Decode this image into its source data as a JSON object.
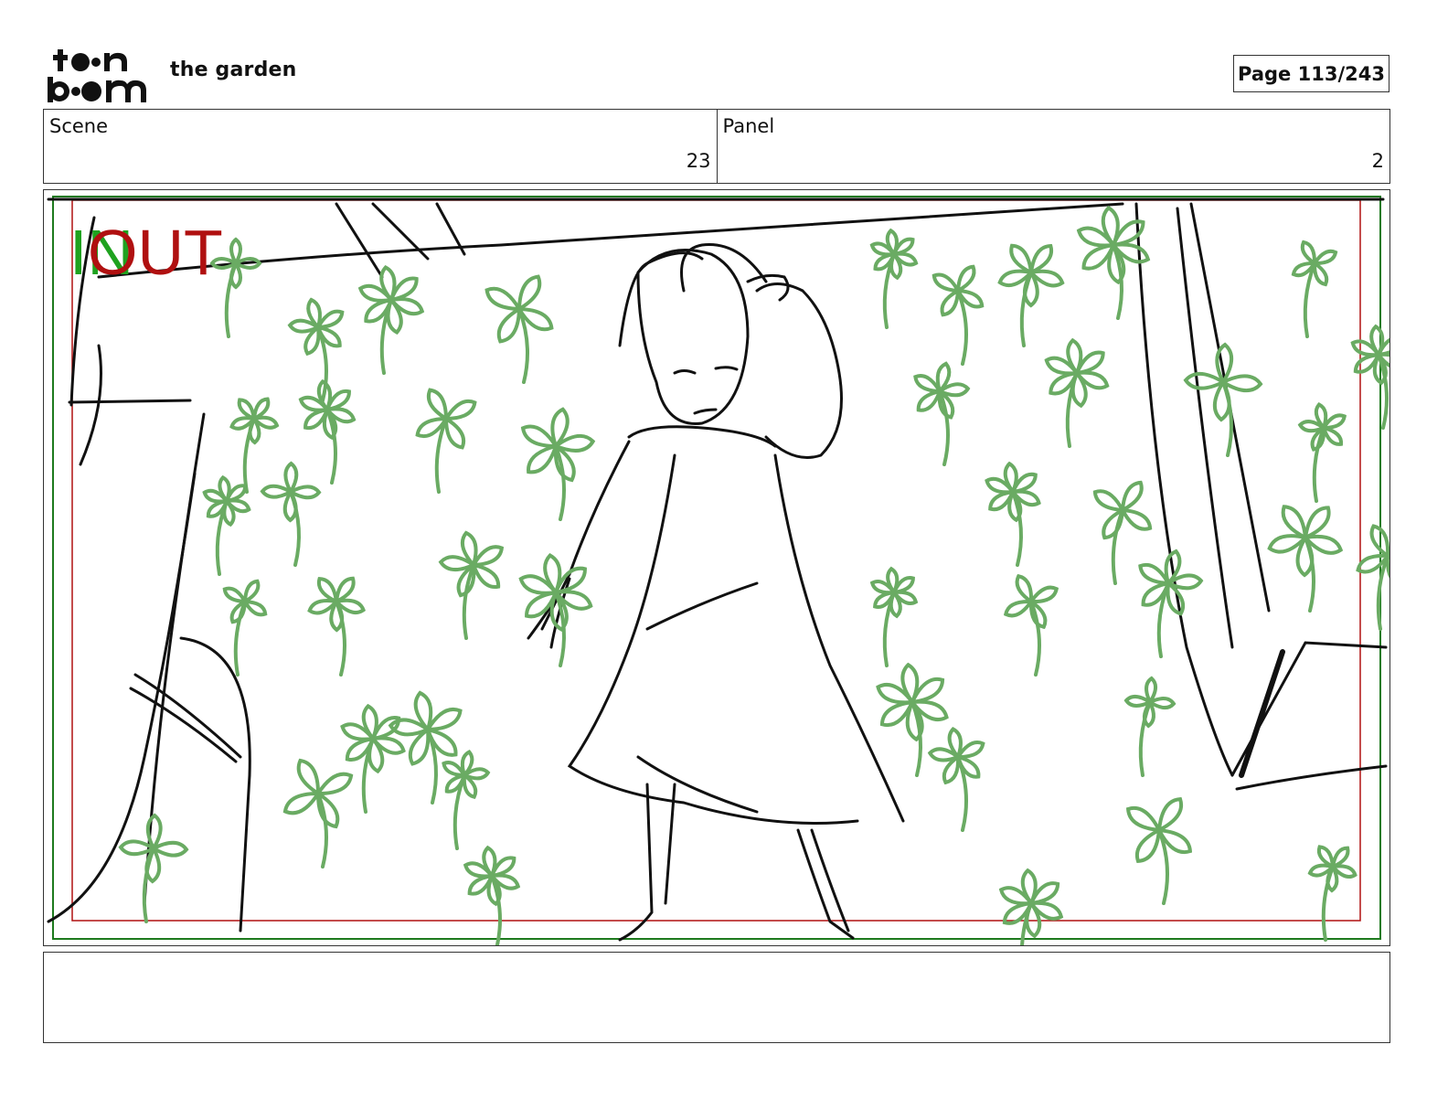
{
  "header": {
    "logo_text": "toon boom",
    "project_title": "the garden",
    "page_label": "Page 113/243"
  },
  "scene": {
    "label": "Scene",
    "value": "23"
  },
  "panel": {
    "label": "Panel",
    "value": "2"
  },
  "frame": {
    "in_marker": "IN",
    "out_marker": "OUT",
    "in_color": "#1fa21f",
    "out_color": "#b01010",
    "sketch_color": "#111111",
    "foliage_color": "#6aab63"
  },
  "notes": {
    "text": ""
  }
}
